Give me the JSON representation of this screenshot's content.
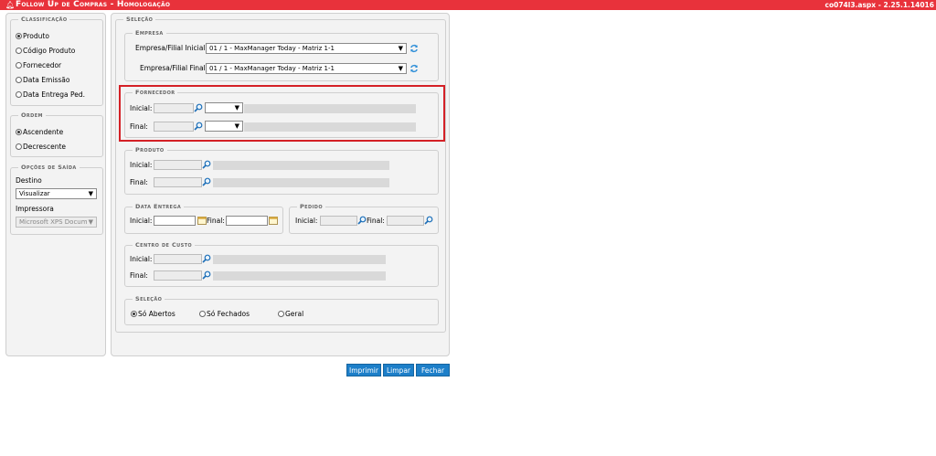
{
  "header": {
    "title": "Follow Up de Compras  - Homologação",
    "version": "co074l3.aspx - 2.25.1.14016"
  },
  "left": {
    "classificacao": {
      "legend": "Classificação",
      "options": [
        "Produto",
        "Código Produto",
        "Fornecedor",
        "Data Emissão",
        "Data Entrega Ped."
      ],
      "selected": "Produto"
    },
    "ordem": {
      "legend": "Ordem",
      "options": [
        "Ascendente",
        "Decrescente"
      ],
      "selected": "Ascendente"
    },
    "saida": {
      "legend": "Opções de Saída",
      "destino_label": "Destino",
      "destino_value": "Visualizar",
      "impressora_label": "Impressora",
      "impressora_value": "Microsoft XPS Docum"
    }
  },
  "main": {
    "legend": "Seleção",
    "empresa": {
      "legend": "Empresa",
      "inicial_label": "Empresa/Filial Inicial:",
      "inicial_value": "01 / 1 - MaxManager Today - Matriz 1-1",
      "final_label": "Empresa/Filial Final:",
      "final_value": "01 / 1 - MaxManager Today - Matriz 1-1"
    },
    "fornecedor": {
      "legend": "Fornecedor",
      "inicial_label": "Inicial:",
      "final_label": "Final:"
    },
    "produto": {
      "legend": "Produto",
      "inicial_label": "Inicial:",
      "final_label": "Final:"
    },
    "data_entrega": {
      "legend": "Data Entrega",
      "inicial_label": "Inicial:",
      "final_label": "Final:"
    },
    "pedido": {
      "legend": "Pedido",
      "inicial_label": "Inicial:",
      "final_label": "Final:"
    },
    "centro_custo": {
      "legend": "Centro de Custo",
      "inicial_label": "Inicial:",
      "final_label": "Final:"
    },
    "selecao": {
      "legend": "Seleção",
      "options": [
        "Só Abertos",
        "Só Fechados",
        "Geral"
      ],
      "selected": "Só Abertos"
    }
  },
  "buttons": {
    "imprimir": "Imprimir",
    "limpar": "Limpar",
    "fechar": "Fechar"
  },
  "colors": {
    "header_bg": "#e8323b",
    "button_bg": "#1d7fc9",
    "highlight": "#d42026"
  }
}
